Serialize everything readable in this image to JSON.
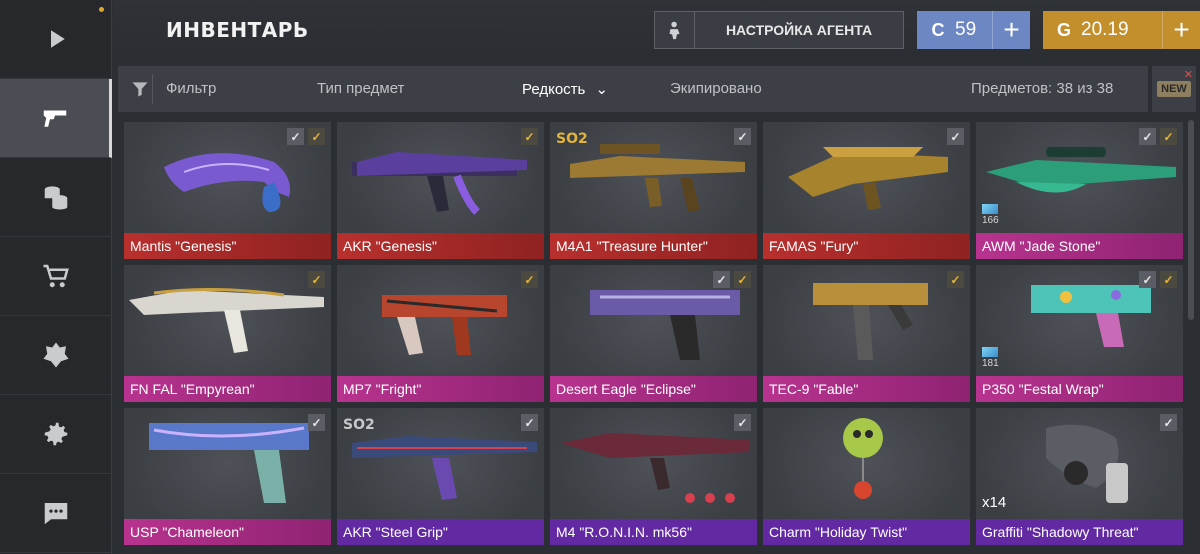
{
  "header": {
    "title": "ИНВЕНТАРЬ",
    "agent_button": "НАСТРОЙКА АГЕНТА",
    "silver_currency": "59",
    "gold_currency": "20.19",
    "plus_label": "+"
  },
  "sidebar": {
    "items": [
      {
        "icon": "play-icon"
      },
      {
        "icon": "pistol-icon",
        "active": true
      },
      {
        "icon": "coins-icon"
      },
      {
        "icon": "cart-icon"
      },
      {
        "icon": "emblem-icon"
      },
      {
        "icon": "gear-icon"
      },
      {
        "icon": "chat-icon"
      }
    ]
  },
  "filters": {
    "filter": "Фильтр",
    "type": "Тип предмет",
    "rarity": "Редкость",
    "equipped": "Экипировано",
    "count": "Предметов: 38 из 38",
    "new_label": "NEW"
  },
  "items": [
    {
      "name": "Mantis \"Genesis\"",
      "rarity": "red"
    },
    {
      "name": "AKR \"Genesis\"",
      "rarity": "red"
    },
    {
      "name": "M4A1 \"Treasure Hunter\"",
      "rarity": "red",
      "badge": "SO2"
    },
    {
      "name": "FAMAS \"Fury\"",
      "rarity": "red"
    },
    {
      "name": "AWM \"Jade Stone\"",
      "rarity": "pink",
      "level": "166"
    },
    {
      "name": "FN FAL \"Empyrean\"",
      "rarity": "pink"
    },
    {
      "name": "MP7 \"Fright\"",
      "rarity": "pink"
    },
    {
      "name": "Desert Eagle \"Eclipse\"",
      "rarity": "pink"
    },
    {
      "name": "TEC-9 \"Fable\"",
      "rarity": "pink"
    },
    {
      "name": "P350 \"Festal Wrap\"",
      "rarity": "pink",
      "level": "181"
    },
    {
      "name": "USP \"Chameleon\"",
      "rarity": "pink"
    },
    {
      "name": "AKR \"Steel Grip\"",
      "rarity": "purple",
      "badge": "SO2"
    },
    {
      "name": "M4 \"R.O.N.I.N. mk56\"",
      "rarity": "purple"
    },
    {
      "name": "Charm \"Holiday Twist\"",
      "rarity": "purple"
    },
    {
      "name": "Graffiti \"Shadowy Threat\"",
      "rarity": "purple",
      "count": "x14"
    }
  ],
  "colors": {
    "red": "#b8302e",
    "pink": "#b8338f",
    "purple": "#6329a3",
    "silver_currency": "#6c87c4",
    "gold_currency": "#c38f2c"
  }
}
